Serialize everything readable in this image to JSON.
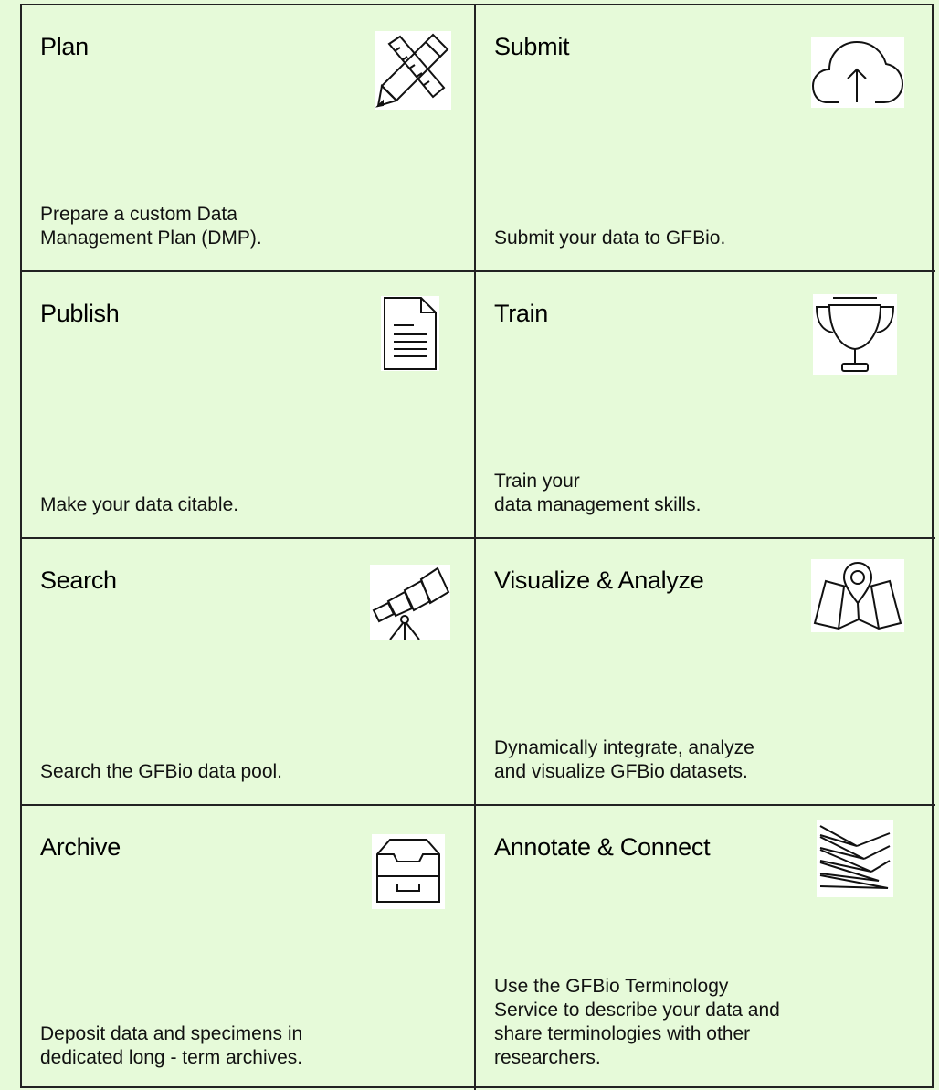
{
  "tiles": [
    {
      "title": "Plan",
      "desc": "Prepare a custom Data\nManagement Plan (DMP).",
      "icon": "pencil-ruler-icon"
    },
    {
      "title": "Submit",
      "desc": "Submit your data to GFBio.",
      "icon": "cloud-upload-icon"
    },
    {
      "title": "Publish",
      "desc": "Make your data citable.",
      "icon": "document-icon"
    },
    {
      "title": "Train",
      "desc": "Train your\ndata management skills.",
      "icon": "trophy-icon"
    },
    {
      "title": "Search",
      "desc": "Search the GFBio data pool.",
      "icon": "telescope-icon"
    },
    {
      "title": "Visualize & Analyze",
      "desc": "Dynamically integrate, analyze\nand visualize GFBio datasets.",
      "icon": "map-pin-icon"
    },
    {
      "title": "Archive",
      "desc": "Deposit data and specimens in\ndedicated long   - term archives.",
      "icon": "archive-drawer-icon"
    },
    {
      "title": "Annotate & Connect",
      "desc": "Use the GFBio Terminology\nService to describe your data and\nshare terminologies with other\nresearchers.",
      "icon": "layers-icon"
    }
  ]
}
